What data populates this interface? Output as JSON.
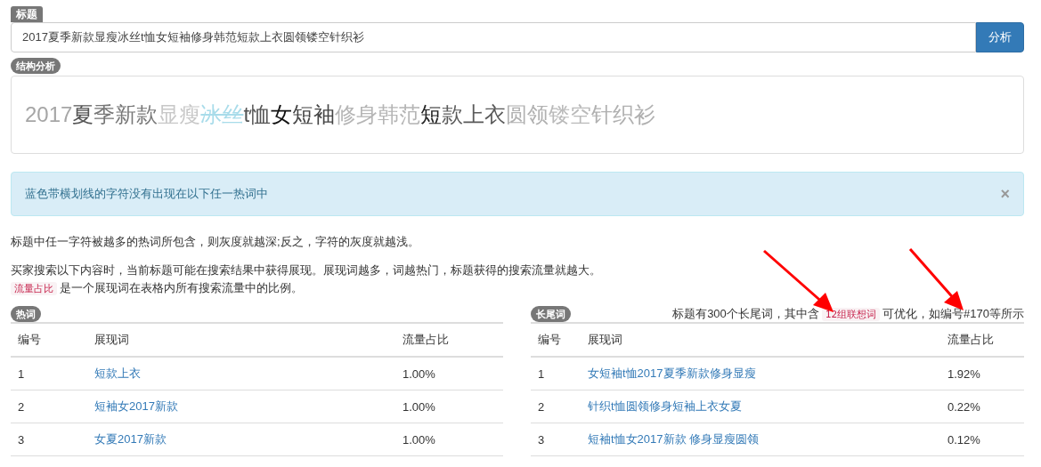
{
  "title_section": {
    "label": "标题",
    "value": "2017夏季新款显瘦冰丝t恤女短袖修身韩范短款上衣圆领镂空针织衫",
    "button": "分析"
  },
  "structure": {
    "label": "结构分析",
    "segments": [
      {
        "text": "2017",
        "color": "#a6a6a6",
        "struck": false
      },
      {
        "text": "夏",
        "color": "#555555",
        "struck": false
      },
      {
        "text": "季新款",
        "color": "#777777",
        "struck": false
      },
      {
        "text": "显瘦",
        "color": "#c8c8c8",
        "struck": false
      },
      {
        "text": "冰丝",
        "color": "#a9dcea",
        "struck": true
      },
      {
        "text": "t恤",
        "color": "#555555",
        "struck": false
      },
      {
        "text": "女",
        "color": "#111111",
        "struck": false
      },
      {
        "text": "短袖",
        "color": "#444444",
        "struck": false
      },
      {
        "text": "修身韩范",
        "color": "#b5b5b5",
        "struck": false
      },
      {
        "text": "短",
        "color": "#222222",
        "struck": false
      },
      {
        "text": "款上衣",
        "color": "#5a5a5a",
        "struck": false
      },
      {
        "text": "圆领",
        "color": "#b0b0b0",
        "struck": false
      },
      {
        "text": "镂空",
        "color": "#bababa",
        "struck": false
      },
      {
        "text": "针织衫",
        "color": "#b0b0b0",
        "struck": false
      }
    ]
  },
  "alert": {
    "text": "蓝色带横划线的字符没有出现在以下任一热词中",
    "close": "×"
  },
  "notes": {
    "line_1": "标题中任一字符被越多的热词所包含，则灰度就越深;反之，字符的灰度就越浅。",
    "line_2": "买家搜索以下内容时，当前标题可能在搜索结果中获得展现。展现词越多，词越热门，标题获得的搜索流量就越大。",
    "tag": "流量占比",
    "line_3": "是一个展现词在表格内所有搜索流量中的比例。"
  },
  "hot_words": {
    "label": "热词",
    "columns": [
      "编号",
      "展现词",
      "流量占比"
    ],
    "rows": [
      {
        "no": "1",
        "word": "短款上衣",
        "share": "1.00%"
      },
      {
        "no": "2",
        "word": "短袖女2017新款",
        "share": "1.00%"
      },
      {
        "no": "3",
        "word": "女夏2017新款",
        "share": "1.00%"
      }
    ]
  },
  "long_tail": {
    "label": "长尾词",
    "summary_prefix": "标题有300个长尾词，其中含",
    "summary_tag": "12组联想词",
    "summary_suffix": "可优化，如编号#170等所示",
    "columns": [
      "编号",
      "展现词",
      "流量占比"
    ],
    "rows": [
      {
        "no": "1",
        "word": "女短袖t恤2017夏季新款修身显瘦",
        "share": "1.92%"
      },
      {
        "no": "2",
        "word": "针织t恤圆领修身短袖上衣女夏",
        "share": "0.22%"
      },
      {
        "no": "3",
        "word": "短袖t恤女2017新款 修身显瘦圆领",
        "share": "0.12%"
      }
    ]
  }
}
